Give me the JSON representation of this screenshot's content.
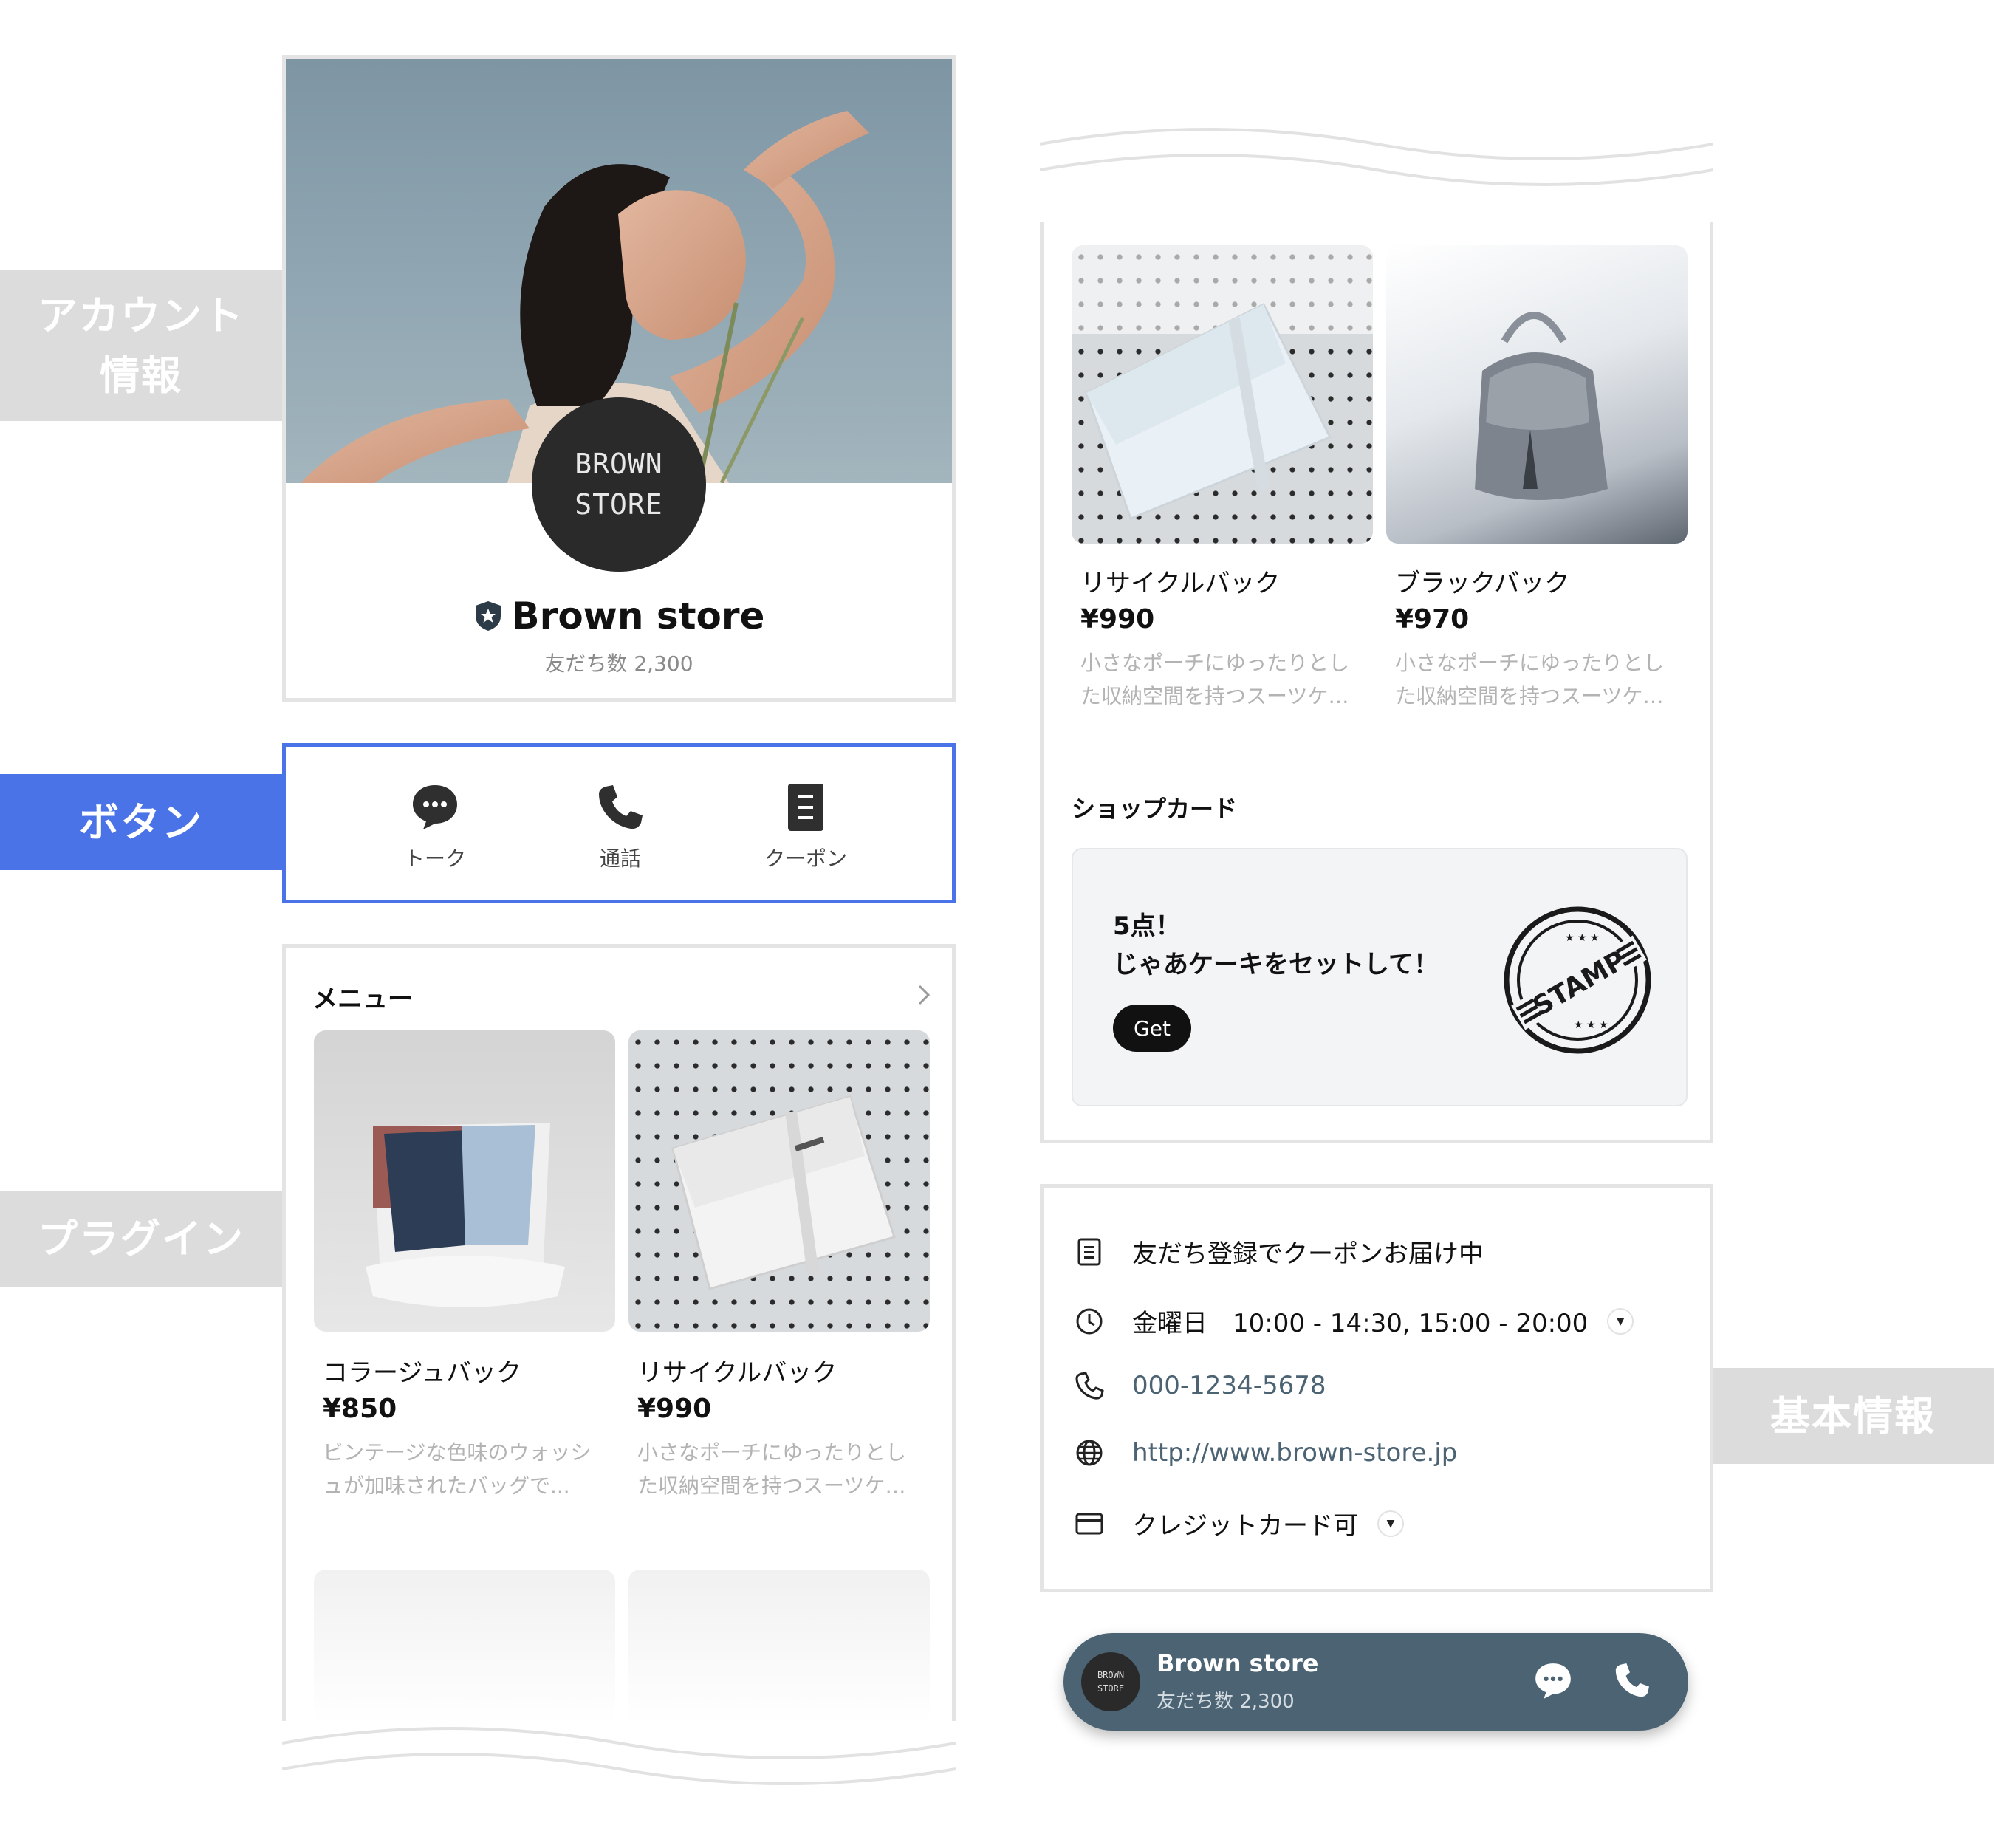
{
  "labels": {
    "account_info": [
      "アカウント",
      "情報"
    ],
    "buttons": "ボタン",
    "plugin": "プラグイン",
    "basic_info": "基本情報"
  },
  "account": {
    "logo_lines": [
      "BROWN",
      "STORE"
    ],
    "name": "Brown store",
    "friends": "友だち数 2,300"
  },
  "actions": [
    {
      "label": "トーク",
      "icon": "chat-bubble-icon"
    },
    {
      "label": "通話",
      "icon": "phone-icon"
    },
    {
      "label": "クーポン",
      "icon": "coupon-icon"
    }
  ],
  "menu": {
    "title": "メニュー",
    "items": [
      {
        "name": "コラージュバック",
        "price": "¥850",
        "desc": "ビンテージな色味のウォッシュが加味されたバッグで..."
      },
      {
        "name": "リサイクルバック",
        "price": "¥990",
        "desc": "小さなポーチにゆったりとした収納空間を持つスーツケ…"
      }
    ]
  },
  "products_right": [
    {
      "name": "リサイクルバック",
      "price": "¥990",
      "desc": "小さなポーチにゆったりとした収納空間を持つスーツケ…"
    },
    {
      "name": "ブラックバック",
      "price": "¥970",
      "desc": "小さなポーチにゆったりとした収納空間を持つスーツケ…"
    }
  ],
  "shop_card": {
    "title": "ショップカード",
    "line1": "5点！",
    "line2": "じゃあケーキをセットして！",
    "button": "Get",
    "stamp_text": "STAMP"
  },
  "basic_info": {
    "coupon": "友だち登録でクーポンお届け中",
    "hours": "金曜日　10:00 - 14:30, 15:00 - 20:00",
    "phone": "000-1234-5678",
    "url": "http://www.brown-store.jp",
    "payment": "クレジットカード可"
  },
  "footer_bar": {
    "logo_lines": [
      "BROWN",
      "STORE"
    ],
    "name": "Brown store",
    "friends": "友だち数 2,300"
  },
  "colors": {
    "accent_blue": "#4a73e8",
    "label_gray": "#dcdcdc",
    "footer_bar": "#4b6373",
    "link": "#4b6373"
  }
}
